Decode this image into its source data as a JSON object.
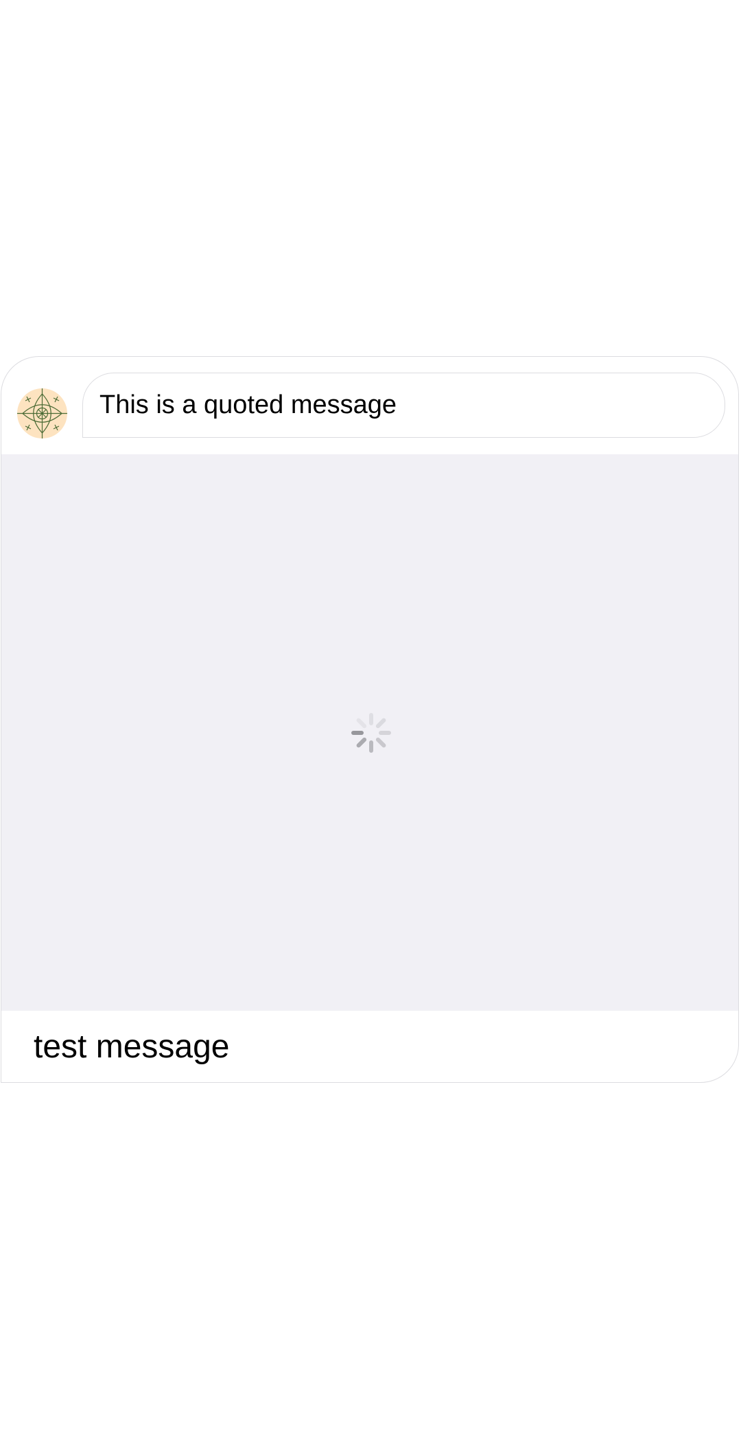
{
  "message": {
    "quoted_text": "This is a quoted message",
    "body_text": "test message",
    "avatar_icon": "avatar-geometric-pattern-icon",
    "media_state_icon": "loading-spinner-icon"
  },
  "colors": {
    "border": "#dcdce0",
    "media_placeholder": "#f1f0f5",
    "avatar_background": "#fde3c0",
    "avatar_pattern": "#4a6b35",
    "spinner": "#8e8e93"
  }
}
